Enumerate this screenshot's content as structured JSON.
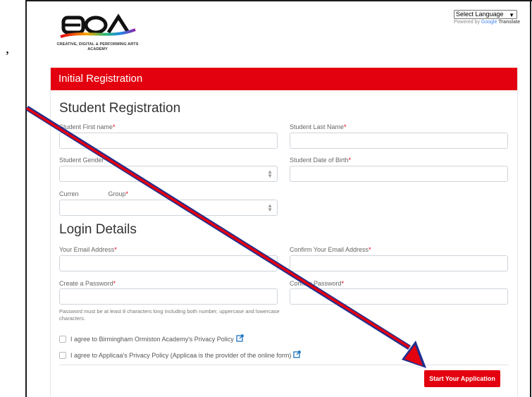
{
  "logo": {
    "letters": "BOA",
    "subtitle_line1": "CREATIVE, DIGITAL & PERFORMING ARTS",
    "subtitle_line2": "ACADEMY"
  },
  "translate": {
    "select_value": "Select Language",
    "powered_prefix": "Powered by",
    "powered_google": "Google",
    "powered_translate": "Translate"
  },
  "stray_text": ",",
  "form": {
    "header": "Initial Registration",
    "student_section": "Student Registration",
    "first_name_label": "Student First name",
    "last_name_label": "Student Last Name",
    "gender_label": "Student Gender",
    "dob_label": "Student Date of Birth",
    "year_group_label_left": "Curren",
    "year_group_label_right": "Group",
    "login_section": "Login Details",
    "email_label": "Your Email Address",
    "confirm_email_label": "Confirm Your Email Address",
    "password_label": "Create a Password",
    "confirm_password_label": "Confirm Password",
    "password_hint": "Password must be at least 8 characters long including both number, uppercase and lowercase characters.",
    "privacy_boa": "I agree to Birmingham Ormiston Academy's Privacy Policy",
    "privacy_applicaa": "I agree to Applicaa's Privacy Policy (Applicaa is the provider of the online form)",
    "required_mark": "*",
    "submit_label": "Start Your Application"
  },
  "colors": {
    "brand_red": "#e3000f",
    "annotation_arrow_fill": "#e3000f",
    "annotation_arrow_outline": "#1f2f8f"
  },
  "icons": {
    "select_arrow": "up-down-caret-icon",
    "external_link": "external-link-icon",
    "annotation": "arrow-pointer-annotation"
  }
}
